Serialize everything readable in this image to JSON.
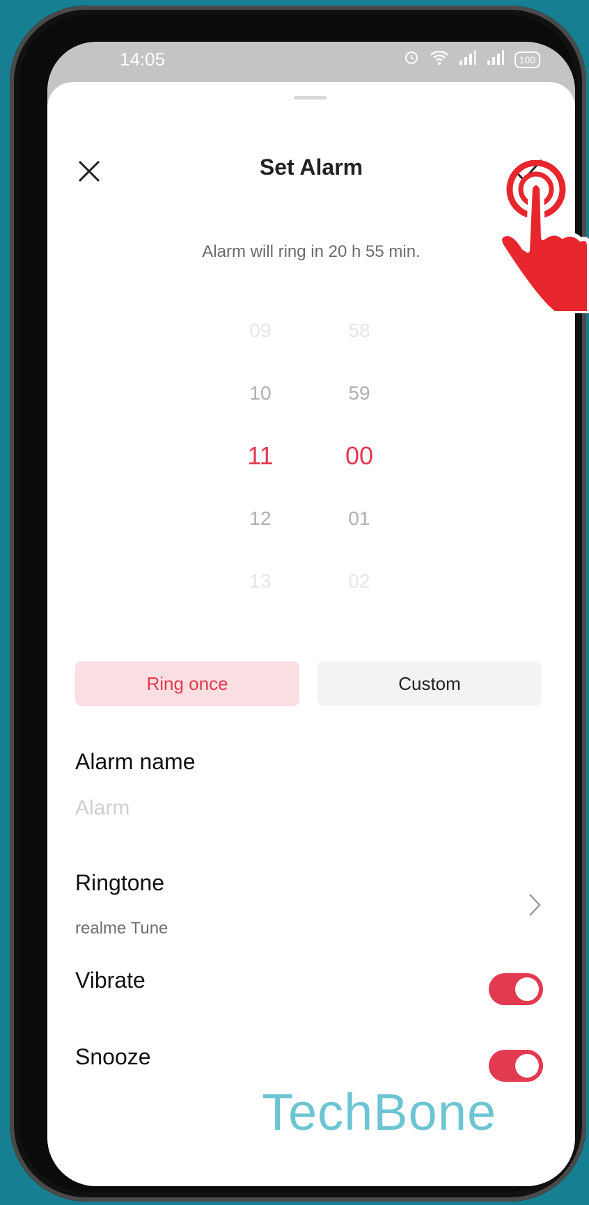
{
  "status": {
    "time": "14:05",
    "battery": "100"
  },
  "header": {
    "title": "Set Alarm"
  },
  "subtitle": "Alarm will ring in 20 h 55 min.",
  "picker": {
    "hours": [
      "09",
      "10",
      "11",
      "12",
      "13"
    ],
    "minutes": [
      "58",
      "59",
      "00",
      "01",
      "02"
    ]
  },
  "repeat": {
    "ring_once": "Ring once",
    "custom": "Custom",
    "selected": "Ring once"
  },
  "alarm_name": {
    "label": "Alarm name",
    "placeholder": "Alarm",
    "value": ""
  },
  "ringtone": {
    "label": "Ringtone",
    "value": "realme Tune"
  },
  "vibrate": {
    "label": "Vibrate",
    "on": true
  },
  "snooze": {
    "label": "Snooze",
    "on": true
  },
  "colors": {
    "accent": "#e23a50",
    "background": "#167f91"
  },
  "watermark": "TechBone"
}
